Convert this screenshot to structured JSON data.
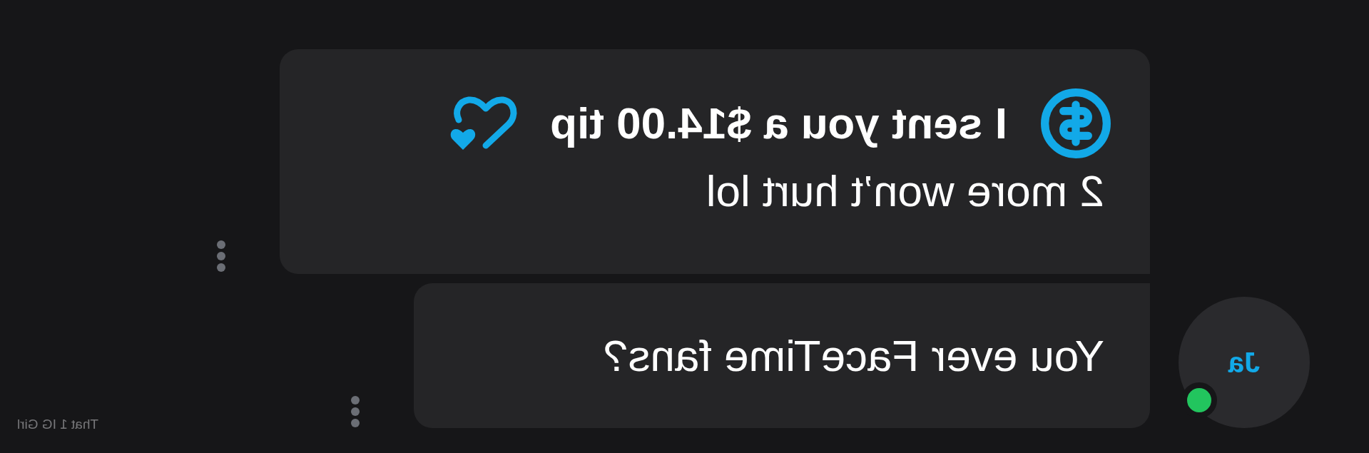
{
  "messages": [
    {
      "kind": "tip",
      "title": "I sent you a $14.00 tip",
      "text": "2 more won’t hurt lol"
    },
    {
      "kind": "text",
      "text": "You ever FaceTime fans?"
    }
  ],
  "avatar": {
    "initials": "Ja",
    "online": true
  },
  "sender_name": "That 1 IG Girl"
}
